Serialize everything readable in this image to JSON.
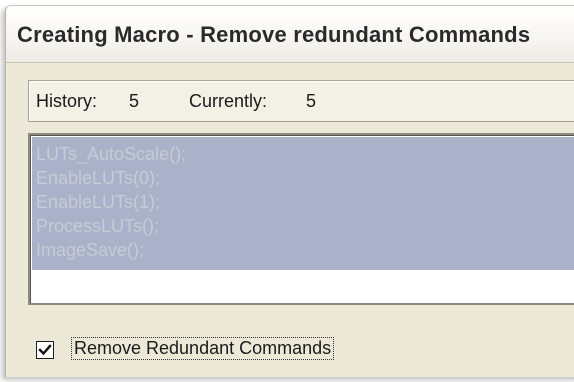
{
  "window": {
    "title": "Creating Macro - Remove redundant Commands"
  },
  "status": {
    "history_label": "History:",
    "history_value": "5",
    "currently_label": "Currently:",
    "currently_value": "5"
  },
  "history_list": {
    "items": [
      "LUTs_AutoScale();",
      "EnableLUTs(0);",
      "EnableLUTs(1);",
      "ProcessLUTs();",
      "ImageSave();"
    ]
  },
  "options": {
    "remove_redundant_label": "Remove Redundant Commands",
    "remove_redundant_checked": true
  }
}
